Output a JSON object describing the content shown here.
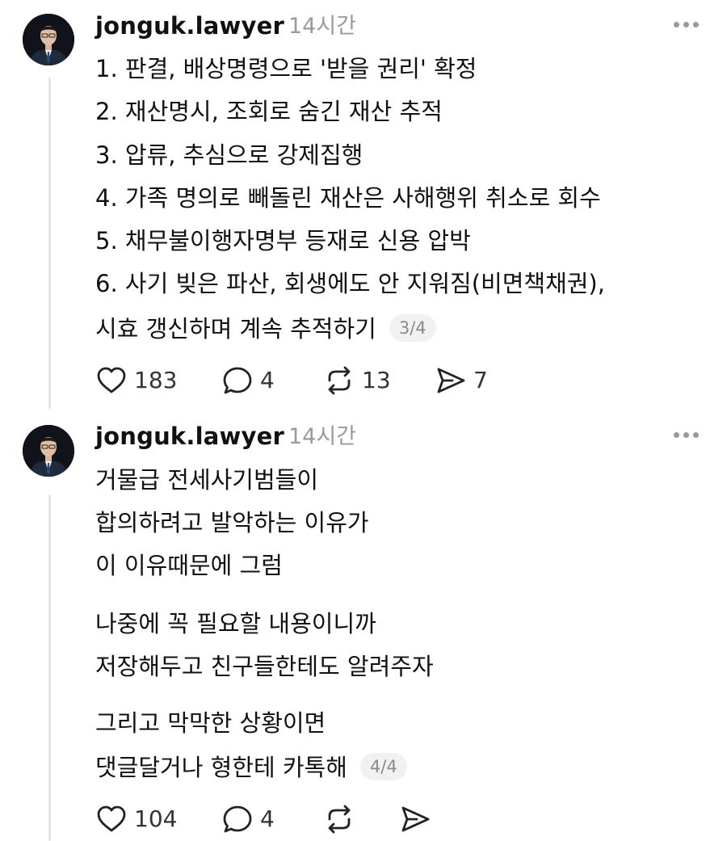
{
  "posts": [
    {
      "username": "jonguk.lawyer",
      "time": "14시간",
      "lines": [
        "1. 판결, 배상명령으로 '받을 권리' 확정",
        "2. 재산명시, 조회로 숨긴 재산 추적",
        "3. 압류, 추심으로 강제집행",
        "4. 가족 명의로 빼돌린 재산은 사해행위 취소로 회수",
        "5. 채무불이행자명부 등재로 신용 압박",
        "6. 사기 빚은 파산, 회생에도 안 지워짐(비면책채권),",
        "시효 갱신하며 계속 추적하기"
      ],
      "page_indicator": "3/4",
      "actions": {
        "likes": "183",
        "comments": "4",
        "reposts": "13",
        "shares": "7"
      }
    },
    {
      "username": "jonguk.lawyer",
      "time": "14시간",
      "lines": [
        "거물급 전세사기범들이",
        "합의하려고 발악하는 이유가",
        "이 이유때문에 그럼",
        "나중에 꼭 필요할 내용이니까",
        "저장해두고 친구들한테도 알려주자",
        "그리고 막막한 상황이면",
        "댓글달거나 형한테 카톡해"
      ],
      "page_indicator": "4/4",
      "actions": {
        "likes": "104",
        "comments": "4",
        "reposts": "",
        "shares": ""
      }
    }
  ],
  "icons": [
    "heart-icon",
    "comment-icon",
    "repost-icon",
    "share-icon",
    "more-icon"
  ],
  "colors": {
    "text": "#111111",
    "muted": "#9a9a9a",
    "badge_bg": "#f1f1f1",
    "thread_line": "#e6e6e6"
  }
}
